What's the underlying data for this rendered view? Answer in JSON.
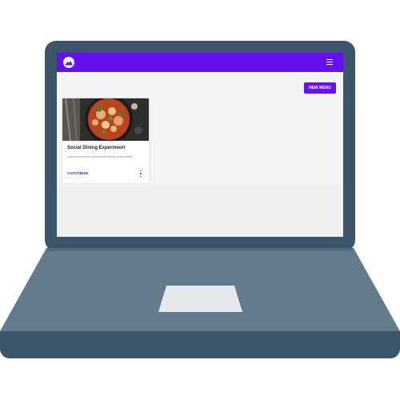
{
  "app": {
    "logo_icon": "mountain-logo-icon",
    "menu_icon": "hamburger-menu-icon",
    "brand_color": "#6610f2"
  },
  "toolbar": {
    "new_menu_label": "NEW MENU"
  },
  "menus": [
    {
      "title": "Social Dining Experiment",
      "url": "www.eocemenu.com/social-dining-experiment",
      "image": "pasta-bowl-image",
      "action_label": "CUSTOMIZE",
      "more_icon": "more-vert-icon"
    }
  ]
}
